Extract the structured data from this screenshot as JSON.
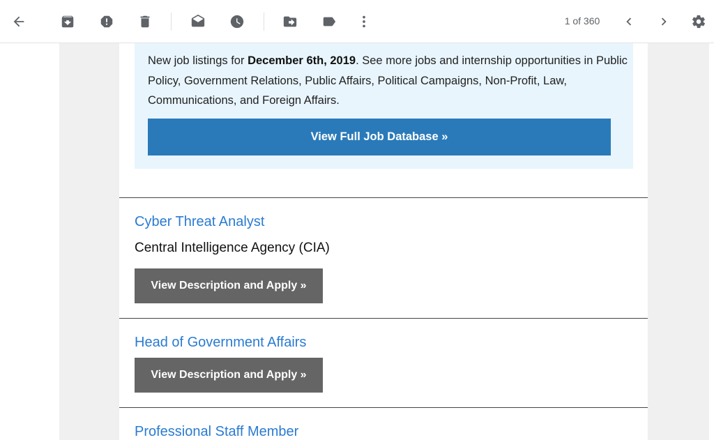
{
  "toolbar": {
    "back_icon": "arrow-back-icon",
    "archive_icon": "archive-icon",
    "spam_icon": "report-spam-icon",
    "delete_icon": "trash-icon",
    "mark_unread_icon": "mark-unread-icon",
    "snooze_icon": "clock-icon",
    "move_icon": "move-to-icon",
    "label_icon": "label-icon",
    "more_icon": "more-vert-icon",
    "counter": "1 of 360",
    "prev_icon": "chevron-left-icon",
    "next_icon": "chevron-right-icon",
    "settings_icon": "gear-icon"
  },
  "email": {
    "intro_prefix": "New job listings for ",
    "intro_date": "December 6th, 2019",
    "intro_suffix": ". See more jobs and internship opportunities in Public Policy, Government Relations, Public Affairs, Political Campaigns, Non-Profit, Law, Communications, and Foreign Affairs.",
    "database_button": "View Full Job Database »",
    "jobs": [
      {
        "title": "Cyber Threat Analyst",
        "organization": "Central Intelligence Agency (CIA)",
        "button": "View Description and Apply »"
      },
      {
        "title": "Head of Government Affairs",
        "button": "View Description and Apply »"
      },
      {
        "title": "Professional Staff Member"
      }
    ]
  },
  "colors": {
    "intro_background": "#e8f5fd",
    "database_button": "#2a7ab9",
    "job_title_link": "#2a7bd1",
    "apply_button": "#656565"
  }
}
